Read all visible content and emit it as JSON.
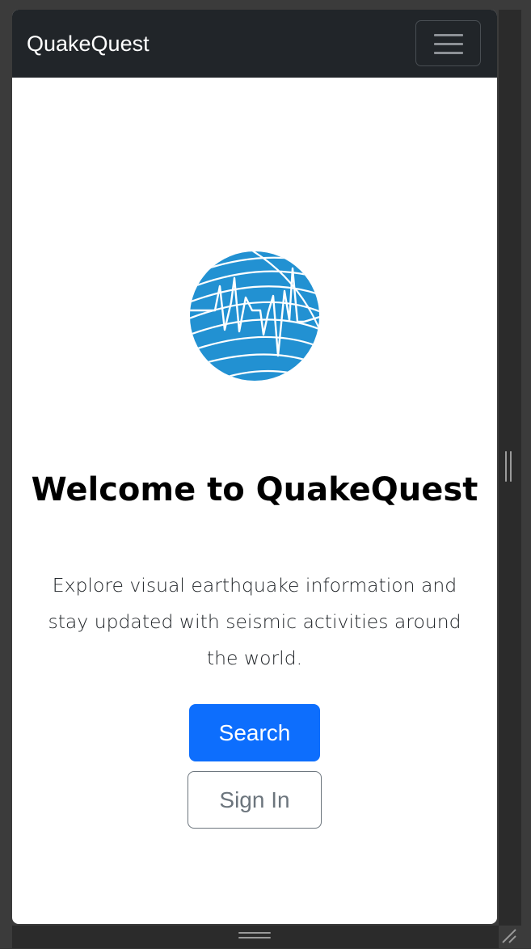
{
  "navbar": {
    "brand": "QuakeQuest",
    "menu_icon": "hamburger-menu-icon"
  },
  "hero": {
    "logo_icon": "seismograph-globe-icon",
    "title": "Welcome to QuakeQuest",
    "description": "Explore visual earthquake information and stay updated with seismic activities around the world.",
    "primary_button": "Search",
    "secondary_button": "Sign In"
  },
  "colors": {
    "navbar_bg": "#212529",
    "primary": "#0d6efd",
    "secondary": "#6c757d",
    "logo_blue": "#2291d2"
  }
}
